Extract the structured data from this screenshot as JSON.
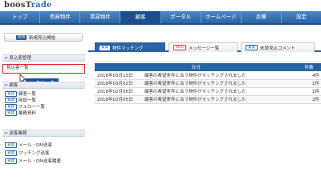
{
  "logo": {
    "text_a": "boosT",
    "text_b": "rade"
  },
  "nav": [
    "トップ",
    "売買物件",
    "賃貸物件",
    "顧客",
    "ポータル",
    "ホームページ",
    "反響",
    "設定"
  ],
  "sidebar": {
    "new_badge": "追加",
    "new_label": "新規見込開始",
    "sec1_title": "見込客管理",
    "highlighted_item": "見込客一覧",
    "click_label": "クリック",
    "sec2_title": "顧客",
    "sec2_items": [
      {
        "badge": "賃貸",
        "label": "顧客一覧"
      },
      {
        "badge": "賃貸",
        "label": "商談一覧"
      },
      {
        "badge": "賃貸",
        "label": "フォロー一覧"
      },
      {
        "badge": "賃貸",
        "label": "業務資料"
      }
    ],
    "sec3_title": "送客業務",
    "sec3_items": [
      {
        "badge": "賃貸",
        "label": "メール・DM送客"
      },
      {
        "badge": "賃貸",
        "label": "マッチング送客"
      },
      {
        "badge": "賃貸",
        "label": "メール・DM送客履歴"
      }
    ]
  },
  "tabs": [
    {
      "badge": "賃貸",
      "label": "物件マッチング"
    },
    {
      "badge": "Web",
      "label": "メッセージ一覧"
    },
    {
      "badge": "賃貸",
      "label": "未読見込コメント"
    }
  ],
  "table": {
    "headers": {
      "date": "日付",
      "msg": "",
      "count": "件数"
    },
    "rows": [
      {
        "date": "2018年03月13日",
        "msg": "顧客の希望条件に合う物件がマッチングされました",
        "count": "4件"
      },
      {
        "date": "2018年03月02日",
        "msg": "顧客の希望条件に合う物件がマッチングされました",
        "count": "1件"
      },
      {
        "date": "2018年02月06日",
        "msg": "顧客の希望条件に合う物件がマッチングされました",
        "count": "1件"
      },
      {
        "date": "2018年02月05日",
        "msg": "顧客の希望条件に合う物件がマッチングされました",
        "count": "2件"
      }
    ]
  },
  "colors": {
    "accent": "#2a63a3",
    "highlight": "#e02525"
  }
}
